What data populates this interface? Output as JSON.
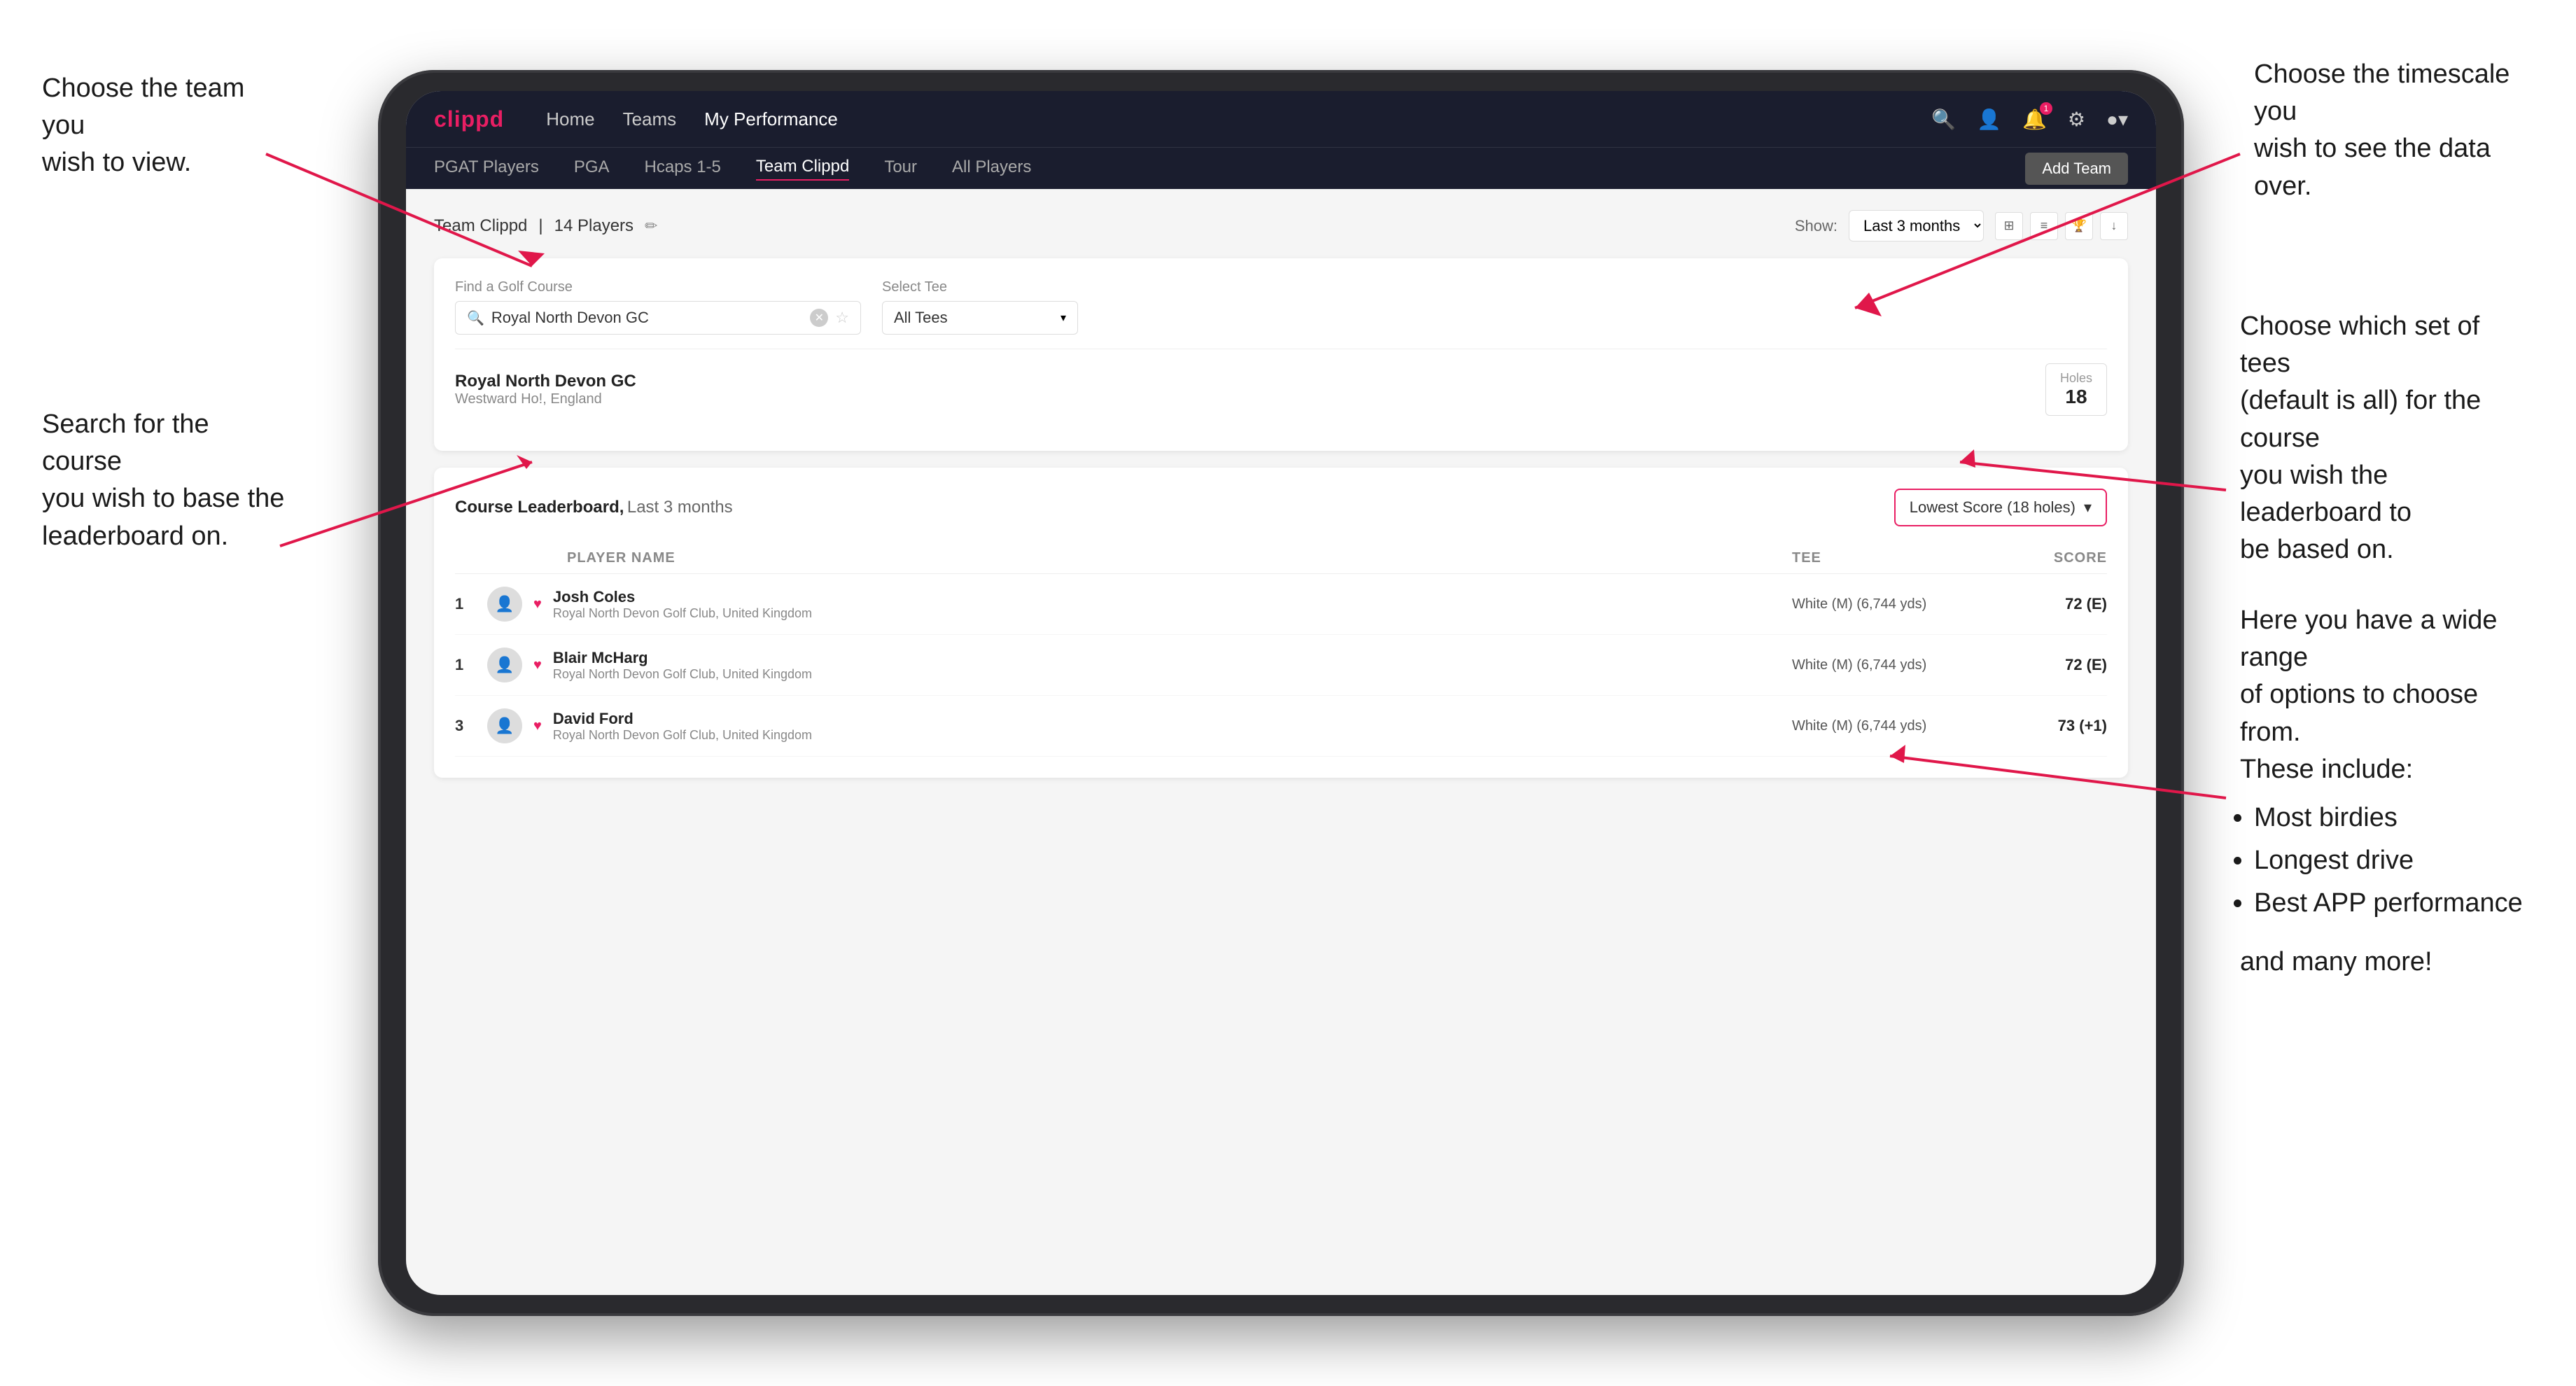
{
  "annotations": {
    "top_left": {
      "line1": "Choose the team you",
      "line2": "wish to view."
    },
    "top_right": {
      "line1": "Choose the timescale you",
      "line2": "wish to see the data over."
    },
    "mid_left": {
      "line1": "Search for the course",
      "line2": "you wish to base the",
      "line3": "leaderboard on."
    },
    "mid_right": {
      "line1": "Choose which set of tees",
      "line2": "(default is all) for the course",
      "line3": "you wish the leaderboard to",
      "line4": "be based on."
    },
    "bottom_right": {
      "line1": "Here you have a wide range",
      "line2": "of options to choose from.",
      "line3": "These include:",
      "bullets": [
        "Most birdies",
        "Longest drive",
        "Best APP performance"
      ],
      "and_more": "and many more!"
    }
  },
  "nav": {
    "logo": "clippd",
    "links": [
      "Home",
      "Teams",
      "My Performance"
    ],
    "active_link": "My Performance",
    "icons": [
      "search",
      "people",
      "bell",
      "settings",
      "profile"
    ]
  },
  "sub_nav": {
    "links": [
      "PGAT Players",
      "PGA",
      "Hcaps 1-5",
      "Team Clippd",
      "Tour",
      "All Players"
    ],
    "active_link": "Team Clippd",
    "add_team_label": "Add Team"
  },
  "team_header": {
    "title": "Team Clippd",
    "player_count": "14 Players",
    "show_label": "Show:",
    "show_value": "Last 3 months"
  },
  "course_search": {
    "find_label": "Find a Golf Course",
    "search_value": "Royal North Devon GC",
    "select_tee_label": "Select Tee",
    "tee_value": "All Tees",
    "result_name": "Royal North Devon GC",
    "result_location": "Westward Ho!, England",
    "holes_label": "Holes",
    "holes_value": "18"
  },
  "leaderboard": {
    "title": "Course Leaderboard,",
    "subtitle": "Last 3 months",
    "score_type": "Lowest Score (18 holes)",
    "columns": {
      "player": "PLAYER NAME",
      "tee": "TEE",
      "score": "SCORE"
    },
    "players": [
      {
        "rank": "1",
        "name": "Josh Coles",
        "club": "Royal North Devon Golf Club, United Kingdom",
        "tee": "White (M) (6,744 yds)",
        "score": "72 (E)"
      },
      {
        "rank": "1",
        "name": "Blair McHarg",
        "club": "Royal North Devon Golf Club, United Kingdom",
        "tee": "White (M) (6,744 yds)",
        "score": "72 (E)"
      },
      {
        "rank": "3",
        "name": "David Ford",
        "club": "Royal North Devon Golf Club, United Kingdom",
        "tee": "White (M) (6,744 yds)",
        "score": "73 (+1)"
      }
    ]
  }
}
